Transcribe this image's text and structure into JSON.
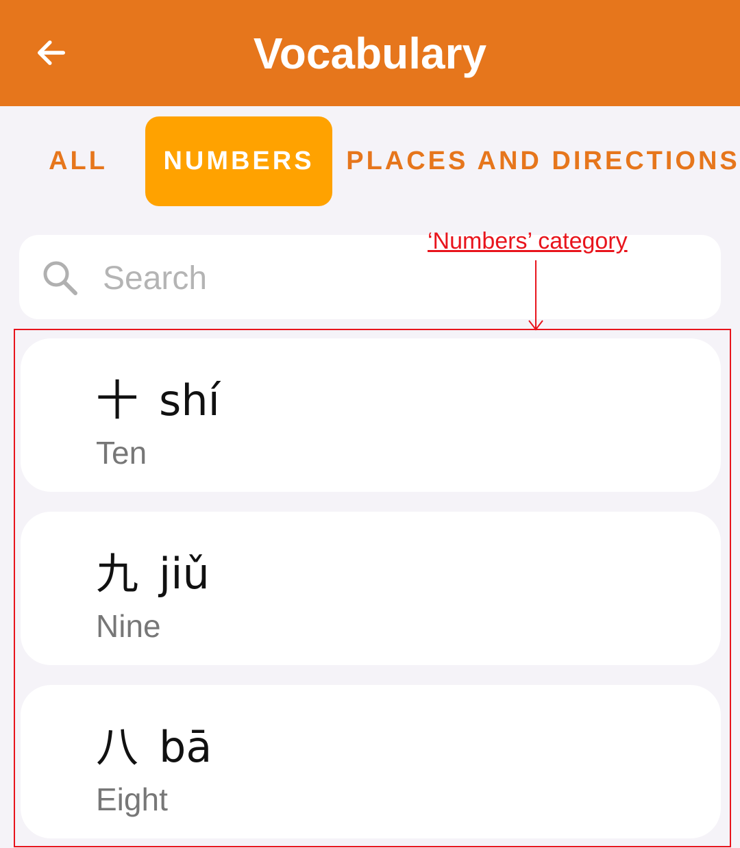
{
  "header": {
    "title": "Vocabulary",
    "back_icon": "arrow-left-icon"
  },
  "tabs": [
    {
      "label": "ALL",
      "selected": false
    },
    {
      "label": "NUMBERS",
      "selected": true
    },
    {
      "label": "PLACES AND DIRECTIONS",
      "selected": false
    }
  ],
  "search": {
    "placeholder": "Search",
    "value": "",
    "icon": "search-icon"
  },
  "annotation": {
    "label": "‘Numbers’ category",
    "color": "#e8141c"
  },
  "words": [
    {
      "character": "十",
      "pinyin": "shí",
      "meaning": "Ten"
    },
    {
      "character": "九",
      "pinyin": "jiǔ",
      "meaning": "Nine"
    },
    {
      "character": "八",
      "pinyin": "bā",
      "meaning": "Eight"
    }
  ],
  "colors": {
    "app_bar": "#e6761c",
    "tab_selected_bg": "#ffa200",
    "tab_text": "#e6761c",
    "background": "#f5f3f8"
  }
}
